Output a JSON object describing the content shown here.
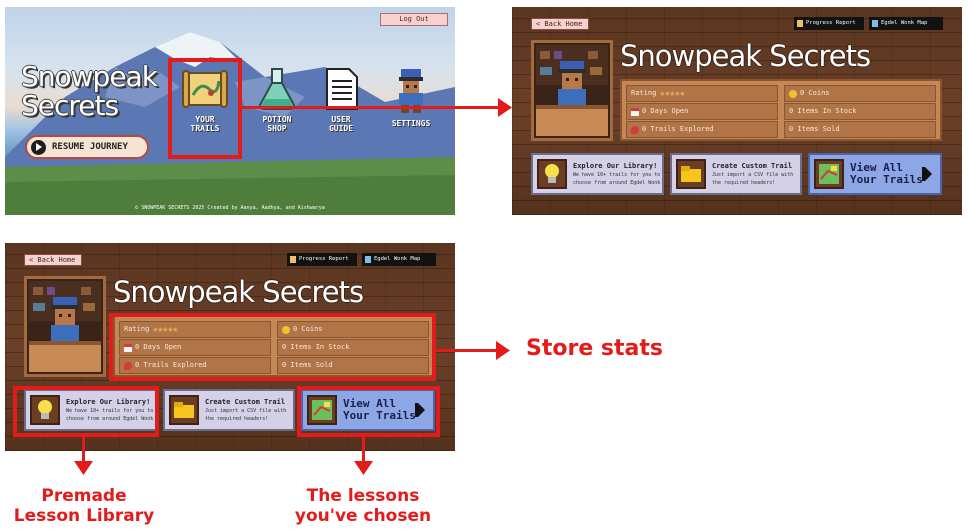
{
  "title_screen": {
    "logout_label": "Log Out",
    "game_title": "Snowpeak Secrets",
    "resume_label": "RESUME JOURNEY",
    "menu": [
      {
        "label_1": "YOUR",
        "label_2": "TRAILS",
        "icon": "map-scroll-icon"
      },
      {
        "label_1": "POTION",
        "label_2": "SHOP",
        "icon": "potion-flask-icon"
      },
      {
        "label_1": "USER",
        "label_2": "GUIDE",
        "icon": "document-icon"
      },
      {
        "label_1": "SETTINGS",
        "label_2": "",
        "icon": "explorer-character-icon"
      }
    ],
    "footer": "© SNOWPEAK SECRETS 2025 Created by Aanya, Aadhya, and Aishwarya"
  },
  "store": {
    "back_label": "< Back Home",
    "progress_label": "Progress Report",
    "map_label": "Egdel Wonk Map",
    "title": "Snowpeak Secrets",
    "stats": {
      "rating_label": "Rating",
      "rating_stars": "★★★★★",
      "days_open": "0 Days Open",
      "trails_explored": "0 Trails Explored",
      "coins": "0 Coins",
      "items_in_stock": "0 Items In Stock",
      "items_sold": "0 Items Sold"
    },
    "actions": {
      "library_title": "Explore Our Library!",
      "library_sub_1": "We have 10+ trails for you to",
      "library_sub_2": "choose from around Egdel Wonk",
      "custom_title": "Create Custom Trail",
      "custom_sub_1": "Just import a CSV file with",
      "custom_sub_2": "the required headers!",
      "view_line_1": "View All",
      "view_line_2": "Your Trails"
    }
  },
  "annotations": {
    "store_stats": "Store stats",
    "premade_1": "Premade",
    "premade_2": "Lesson Library",
    "chosen_1": "The lessons",
    "chosen_2": "you've chosen"
  },
  "colors": {
    "annotation_red": "#e31b1b",
    "wood": "#6b4028",
    "stat_panel": "#c48856",
    "view_button": "#8da6e6"
  }
}
